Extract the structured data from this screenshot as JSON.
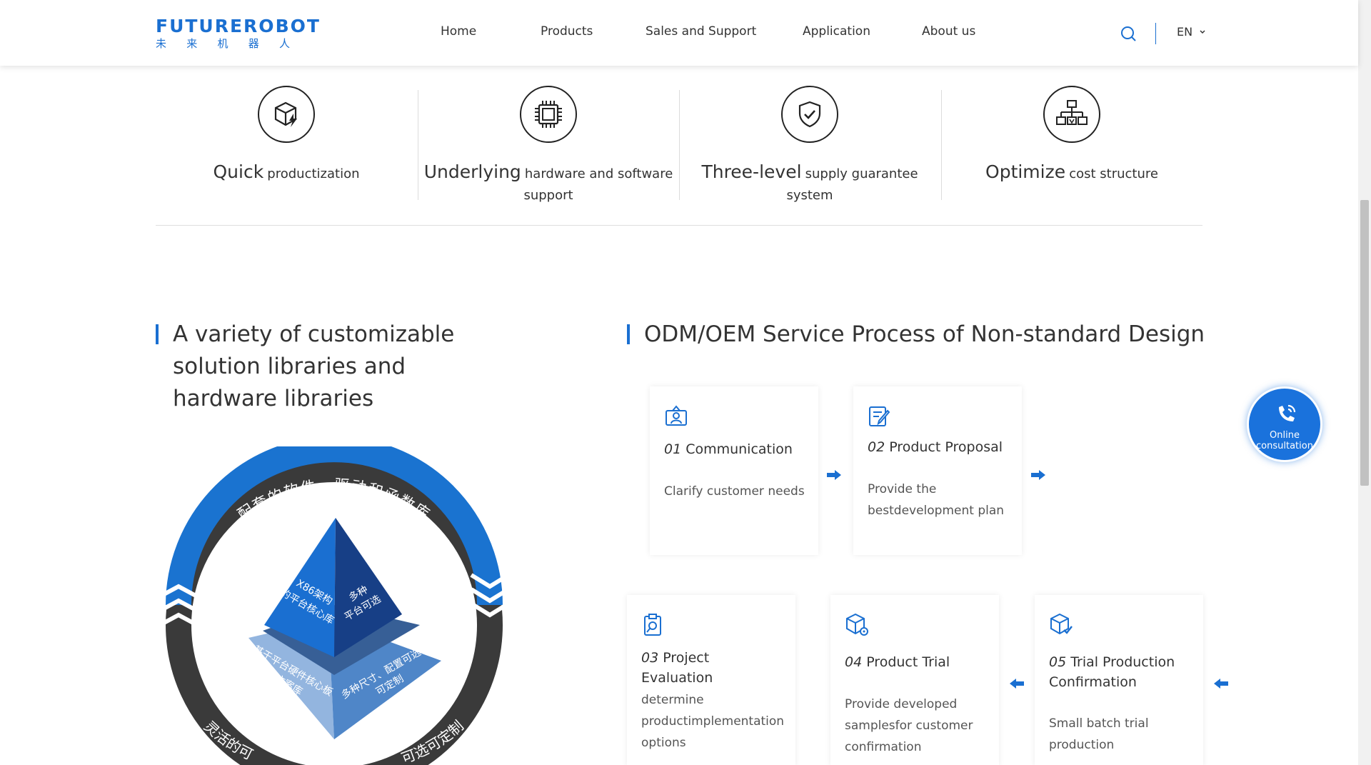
{
  "header": {
    "logo_text": "FUTUREROBOT",
    "logo_cn": [
      "未",
      "来",
      "机",
      "器",
      "人"
    ],
    "nav": [
      "Home",
      "Products",
      "Sales and Support",
      "Application",
      "About us"
    ],
    "lang": "EN"
  },
  "features": [
    {
      "big": "Quick",
      "small": "productization",
      "icon": "box-lightning-icon"
    },
    {
      "big": "Underlying",
      "small": "hardware and software support",
      "icon": "chip-icon"
    },
    {
      "big": "Three-level",
      "small": "supply guarantee system",
      "icon": "shield-check-icon"
    },
    {
      "big": "Optimize",
      "small": "cost structure",
      "icon": "hierarchy-icon"
    }
  ],
  "left_section": {
    "title": "A variety of customizable solution libraries and hardware libraries",
    "ring_top": "配套的软件、驱动和函数库",
    "ring_bottom_left": "灵活的可",
    "ring_bottom_right": "可选可定制",
    "pyramid_left": [
      "X86架构",
      "的平台核心库"
    ],
    "pyramid_right": [
      "多种",
      "平台可选"
    ],
    "base_left": [
      "基于平台硬件核心板",
      "方案库"
    ],
    "base_right": [
      "多种尺寸、配置可选",
      "可定制"
    ]
  },
  "right_section": {
    "title": "ODM/OEM Service Process of Non-standard Design",
    "steps": [
      {
        "num": "01",
        "title": "Communication",
        "desc": "Clarify customer needs",
        "icon": "person-card-icon"
      },
      {
        "num": "02",
        "title": "Product Proposal",
        "desc": "Provide the bestdevelopment plan",
        "icon": "edit-document-icon"
      },
      {
        "num": "03",
        "title": "Project Evaluation",
        "desc": "determine productimplementation options",
        "icon": "clipboard-search-icon"
      },
      {
        "num": "04",
        "title": "Product Trial",
        "desc": "Provide developed samplesfor customer confirmation",
        "icon": "box-gear-icon"
      },
      {
        "num": "05",
        "title": "Trial Production Confirmation",
        "desc": "Small batch trial production",
        "icon": "box-check-icon"
      }
    ]
  },
  "consult": {
    "line1": "Online",
    "line2": "consultation"
  },
  "colors": {
    "accent": "#1a6fd1",
    "dark_ring": "#3a3a3a"
  }
}
